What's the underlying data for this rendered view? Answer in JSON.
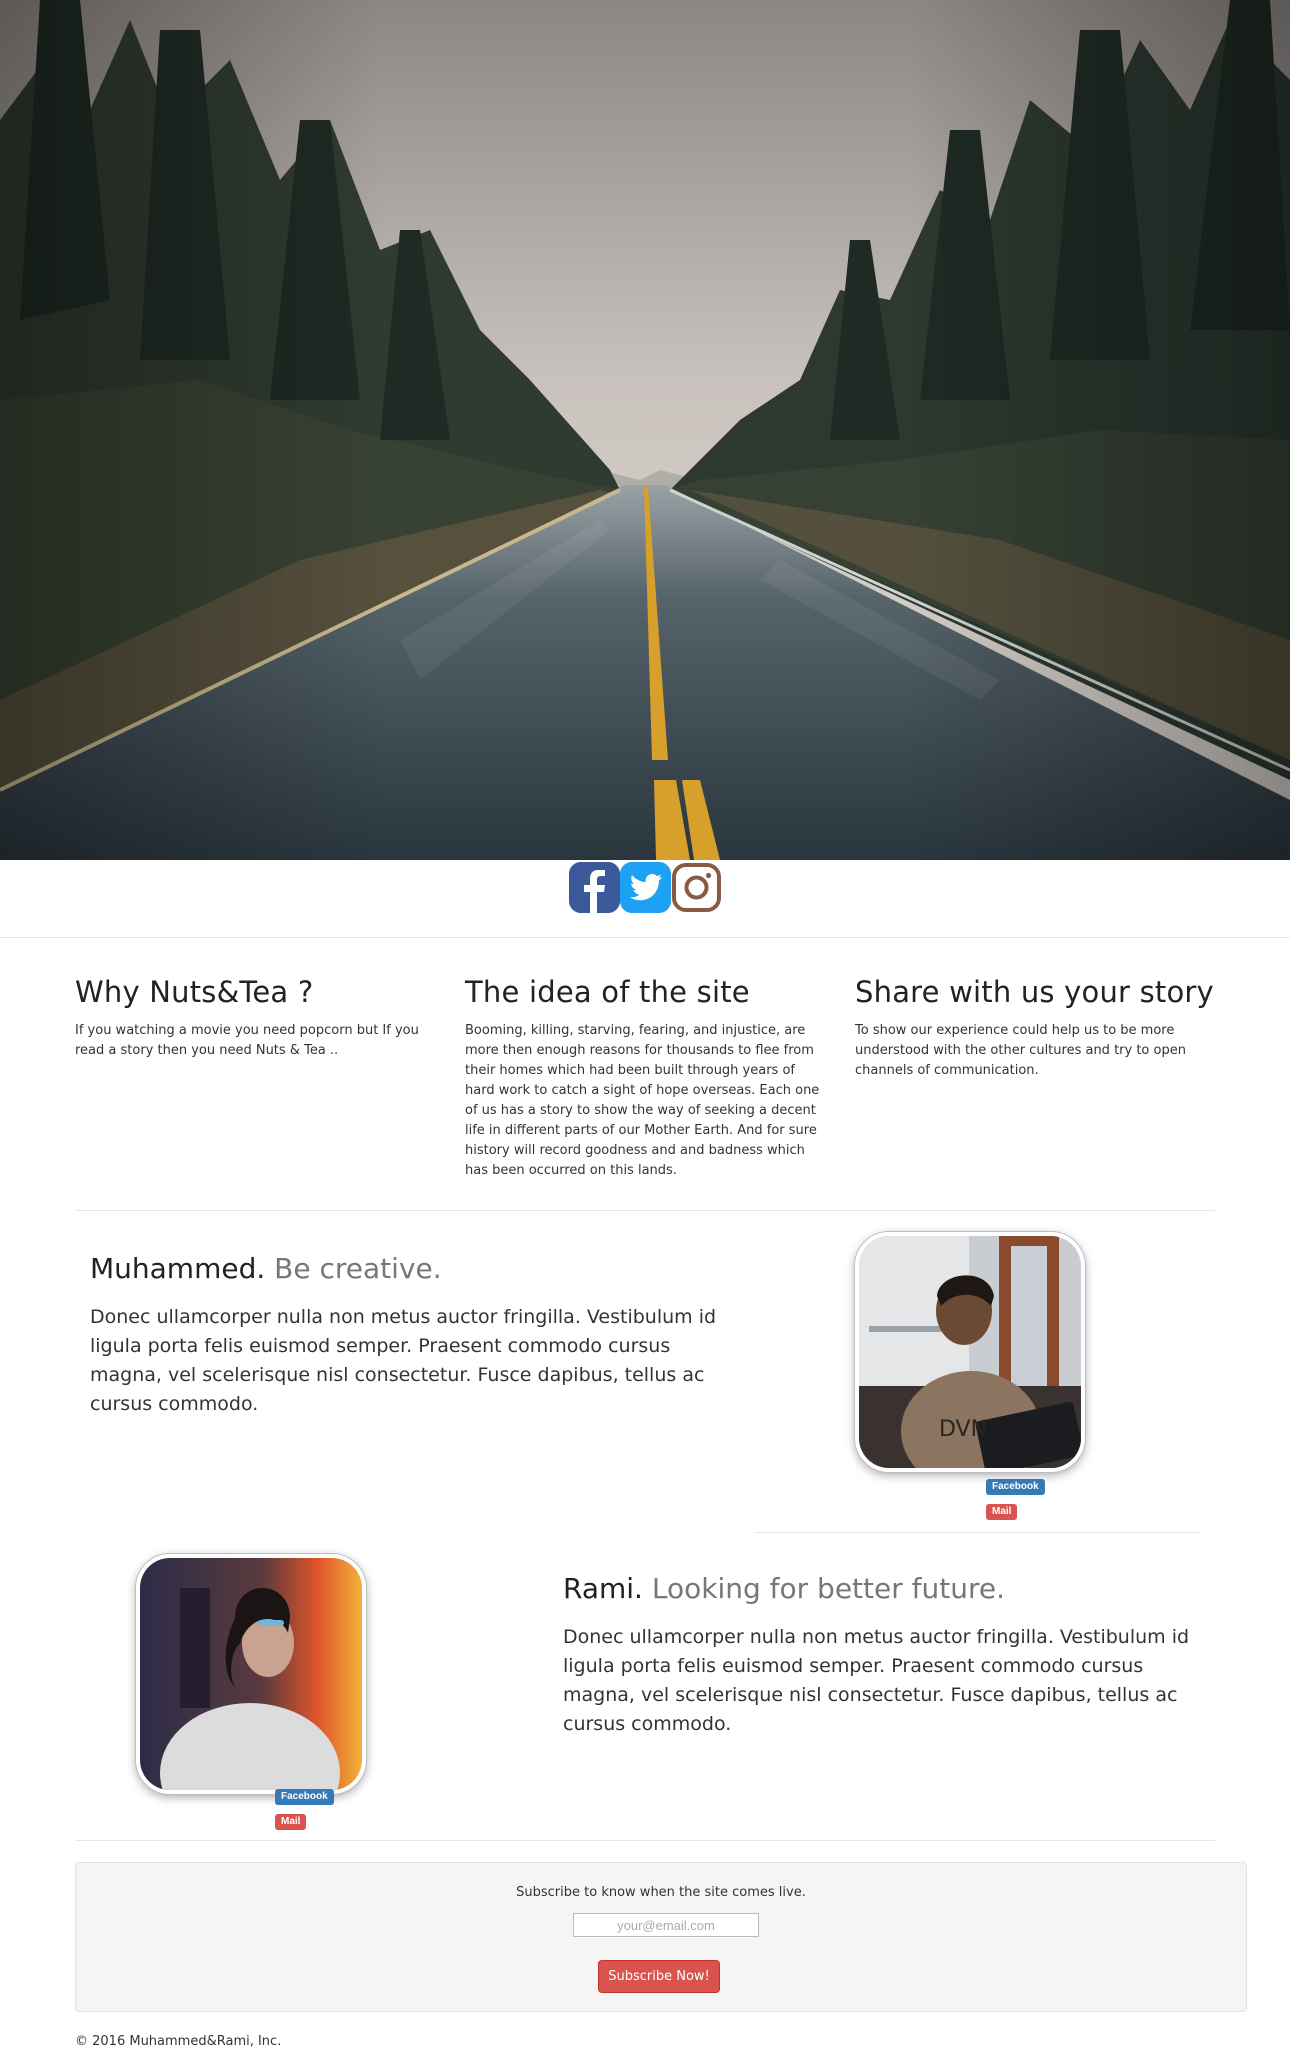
{
  "hero": {
    "image": "rainy-forest-road-photo"
  },
  "social": [
    {
      "name": "Facebook",
      "icon": "facebook-icon",
      "color": "#3b5998"
    },
    {
      "name": "Twitter",
      "icon": "twitter-icon",
      "color": "#1da1f2"
    },
    {
      "name": "Instagram",
      "icon": "instagram-icon",
      "color": "#8a5a44"
    }
  ],
  "features": [
    {
      "title": "Why Nuts&Tea ?",
      "text": "If you watching a movie you need popcorn but If you read a story then you need Nuts & Tea .."
    },
    {
      "title": "The idea of the site",
      "text": "Booming, killing, starving, fearing, and injustice, are more then enough reasons for thousands to flee from their homes which had been built through years of hard work to catch a sight of hope overseas. Each one of us has a story to show the way of seeking a decent life in different parts of our Mother Earth. And for sure history will record goodness and and badness which has been occurred on this lands."
    },
    {
      "title": "Share with us your story",
      "text": "To show our experience could help us to be more understood with the other cultures and try to open channels of communication."
    }
  ],
  "people": [
    {
      "name": "Muhammed.",
      "tagline": "Be creative.",
      "text": "Donec ullamcorper nulla non metus auctor fringilla. Vestibulum id ligula porta felis euismod semper. Praesent commodo cursus magna, vel scelerisque nisl consectetur. Fusce dapibus, tellus ac cursus commodo.",
      "facebook": "Facebook",
      "mail": "Mail"
    },
    {
      "name": "Rami.",
      "tagline": "Looking for better future.",
      "text": "Donec ullamcorper nulla non metus auctor fringilla. Vestibulum id ligula porta felis euismod semper. Praesent commodo cursus magna, vel scelerisque nisl consectetur. Fusce dapibus, tellus ac cursus commodo.",
      "facebook": "Facebook",
      "mail": "Mail"
    }
  ],
  "subscribe": {
    "text": "Subscribe to know when the site comes live.",
    "placeholder": "your@email.com",
    "button": "Subscribe Now!"
  },
  "footer": {
    "text": "© 2016 Muhammed&Rami, Inc."
  },
  "colors": {
    "facebook_badge": "#337ab7",
    "mail_badge": "#d9534f",
    "subscribe_button": "#d9534f"
  }
}
